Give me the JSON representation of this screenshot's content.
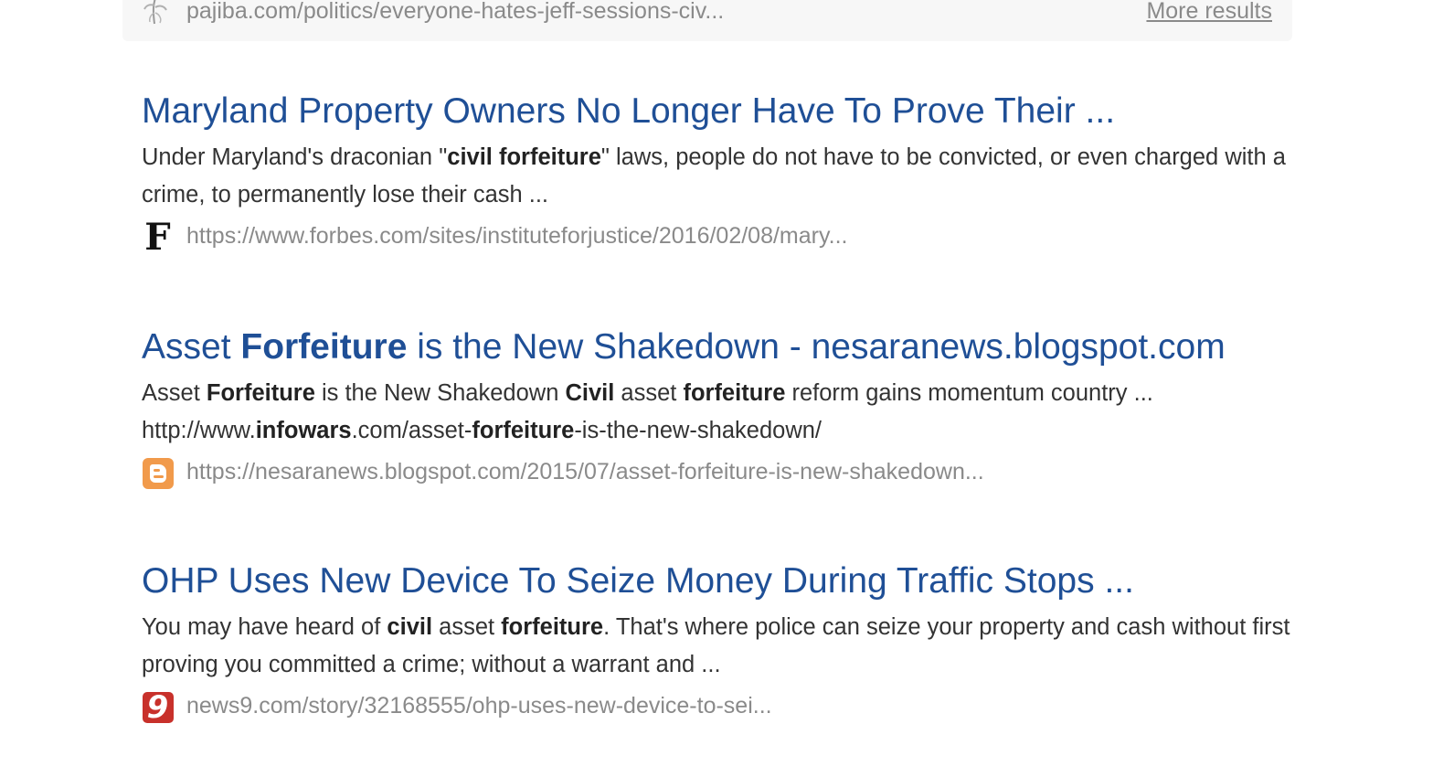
{
  "top_card": {
    "url": "pajiba.com/politics/everyone-hates-jeff-sessions-civ...",
    "more_results": "More results",
    "favicon": "pajiba-favicon-icon"
  },
  "results": [
    {
      "title": "Maryland Property Owners No Longer Have To Prove Their ...",
      "snippet_parts": [
        {
          "text": "Under Maryland's draconian \"",
          "bold": false
        },
        {
          "text": "civil forfeiture",
          "bold": true
        },
        {
          "text": "\" laws, people do not have to be convicted, or even charged with a crime, to permanently lose their cash ...",
          "bold": false
        }
      ],
      "url": "https://www.forbes.com/sites/instituteforjustice/2016/02/08/mary...",
      "favicon": "forbes-favicon-icon",
      "favicon_text": "F"
    },
    {
      "title_parts": [
        {
          "text": "Asset ",
          "bold": false
        },
        {
          "text": "Forfeiture",
          "bold": true
        },
        {
          "text": " is the New Shakedown - nesaranews.blogspot.com",
          "bold": false
        }
      ],
      "snippet_parts": [
        {
          "text": "Asset ",
          "bold": false
        },
        {
          "text": "Forfeiture",
          "bold": true
        },
        {
          "text": " is the New Shakedown ",
          "bold": false
        },
        {
          "text": "Civil",
          "bold": true
        },
        {
          "text": " asset ",
          "bold": false
        },
        {
          "text": "forfeiture",
          "bold": true
        },
        {
          "text": " reform gains momentum country ... http://www.",
          "bold": false
        },
        {
          "text": "infowars",
          "bold": true
        },
        {
          "text": ".com/asset-",
          "bold": false
        },
        {
          "text": "forfeiture",
          "bold": true
        },
        {
          "text": "-is-the-new-shakedown/",
          "bold": false
        }
      ],
      "url": "https://nesaranews.blogspot.com/2015/07/asset-forfeiture-is-new-shakedown...",
      "favicon": "blogger-favicon-icon"
    },
    {
      "title": "OHP Uses New Device To Seize Money During Traffic Stops ...",
      "snippet_parts": [
        {
          "text": "You may have heard of ",
          "bold": false
        },
        {
          "text": "civil",
          "bold": true
        },
        {
          "text": " asset ",
          "bold": false
        },
        {
          "text": "forfeiture",
          "bold": true
        },
        {
          "text": ". That's where police can seize your property and cash without first proving you committed a crime; without a warrant and ...",
          "bold": false
        }
      ],
      "url": "news9.com/story/32168555/ohp-uses-new-device-to-sei...",
      "favicon": "news9-favicon-icon",
      "favicon_text": "9"
    }
  ],
  "colors": {
    "title": "#1f4f96",
    "snippet": "#333333",
    "url": "#8a8a8a",
    "card_bg": "#f7f7f7",
    "blogger": "#f19a4b",
    "news9": "#c8312b"
  }
}
